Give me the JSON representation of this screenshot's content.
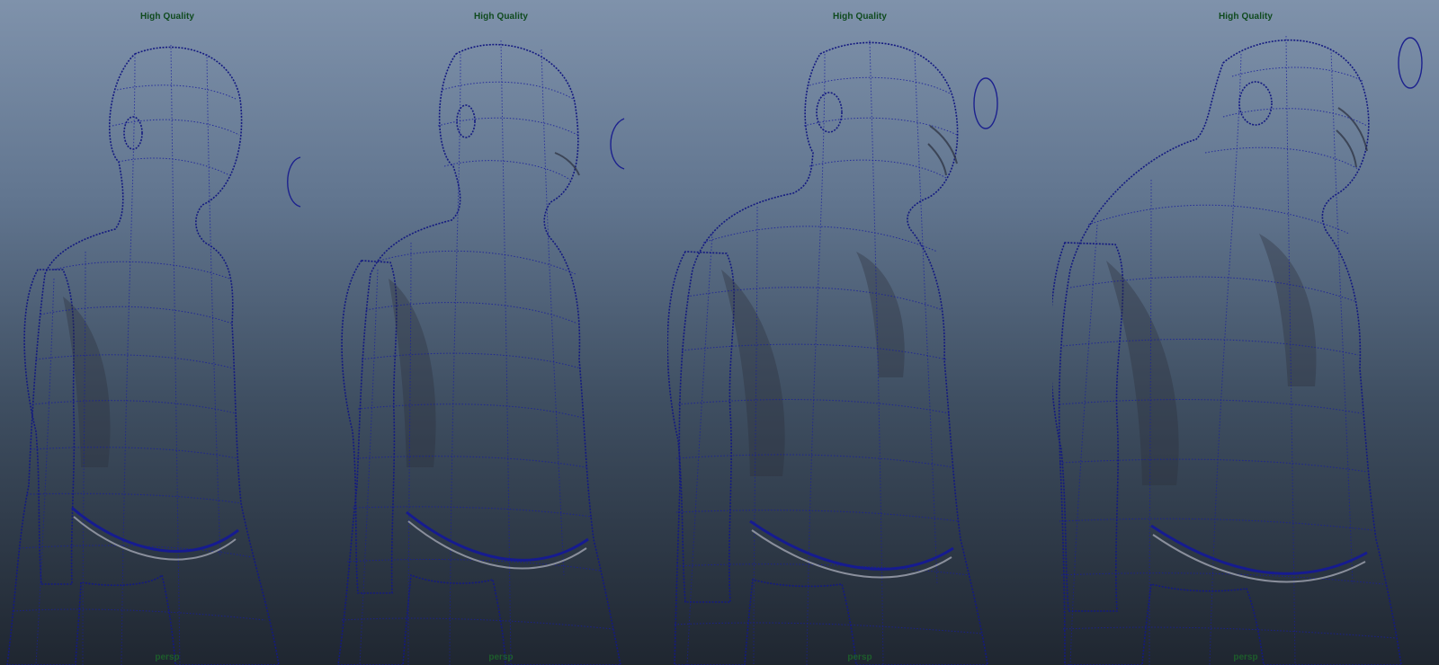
{
  "viewports": [
    {
      "quality_label": "High Quality",
      "camera_label": "persp"
    },
    {
      "quality_label": "High Quality",
      "camera_label": "persp"
    },
    {
      "quality_label": "High Quality",
      "camera_label": "persp"
    },
    {
      "quality_label": "High Quality",
      "camera_label": "persp"
    }
  ],
  "colors": {
    "background_top": "#7f92ab",
    "background_bottom": "#1f2630",
    "mesh_surface": "#c8cace",
    "wireframe": "#1a1f9c",
    "label_text": "#0f4a1e"
  },
  "icons": {
    "manipulator": "camera-manipulator-ellipse-icon"
  }
}
